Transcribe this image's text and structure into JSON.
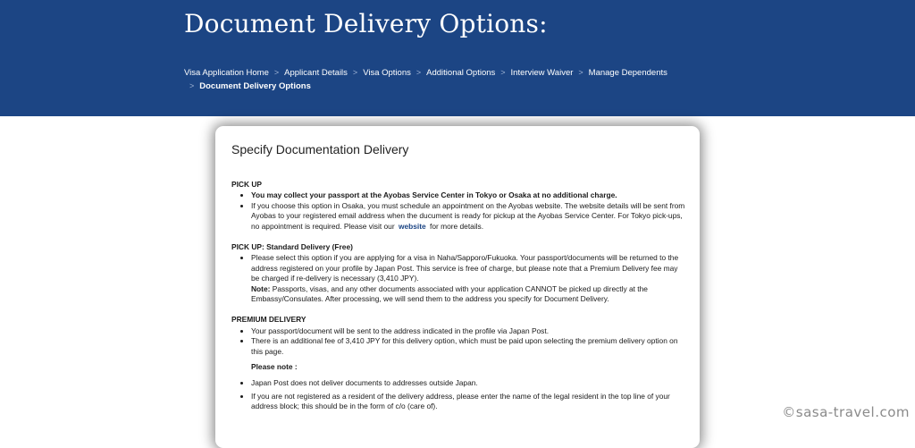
{
  "header": {
    "title": "Document Delivery Options:",
    "breadcrumb": {
      "items": [
        "Visa Application Home",
        "Applicant Details",
        "Visa Options",
        "Additional Options",
        "Interview Waiver",
        "Manage Dependents"
      ],
      "separator": ">",
      "current": "Document Delivery Options"
    },
    "background_color": "#1c4584"
  },
  "card": {
    "title": "Specify Documentation Delivery",
    "pickup": {
      "heading": "PICK UP",
      "bullet1": "You may collect your passport at the Ayobas Service Center in Tokyo or Osaka at no additional charge.",
      "bullet2_before_link": "If you choose this option in Osaka, you must schedule an appointment on the Ayobas website. The website details will be sent from Ayobas to your registered email address when the ducument is ready for pickup at the Ayobas Service Center. For Tokyo pick-ups, no appointment is required. Please visit our",
      "link_text": "website",
      "bullet2_after_link": "for more details."
    },
    "standard": {
      "heading": "PICK UP: Standard Delivery (Free)",
      "bullet1": "Please select this option if you are applying for a visa in Naha/Sapporo/Fukuoka. Your passport/documents will be returned to the address registered on your profile by Japan Post. This service is free of charge, but please note that a Premium Delivery fee may be charged if re-delivery is necessary (3,410 JPY).",
      "note_label": "Note:",
      "note_text": "Passports, visas, and any other documents associated with your application CANNOT be picked up directly at the Embassy/Consulates. After processing, we will send them to the address you specify for Document Delivery."
    },
    "premium": {
      "heading": "PREMIUM DELIVERY",
      "bullet1": "Your passport/document will be sent to the address indicated in the profile via Japan Post.",
      "bullet2": "There is an additional fee of 3,410 JPY for this delivery option, which must be paid upon selecting the premium delivery option on this page.",
      "please_note": "Please note :",
      "bullet3": "Japan Post does not deliver documents to addresses outside Japan.",
      "bullet4": "If you are not registered as a resident of the delivery address, please enter the name of the legal resident in the top line of your address block; this should be in the form of c/o (care of)."
    }
  },
  "watermark": "©sasa-travel.com"
}
